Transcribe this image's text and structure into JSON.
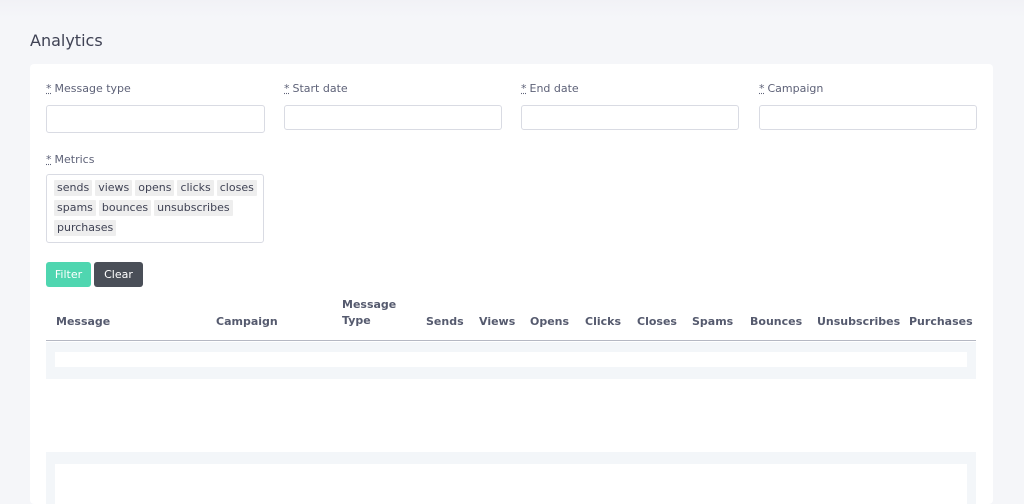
{
  "page": {
    "title": "Analytics"
  },
  "filters": {
    "required_mark": "*",
    "message_type": {
      "label": "Message type",
      "value": "",
      "placeholder": ""
    },
    "start_date": {
      "label": "Start date",
      "value": "",
      "placeholder": ""
    },
    "end_date": {
      "label": "End date",
      "value": "",
      "placeholder": ""
    },
    "campaign": {
      "label": "Campaign",
      "value": "",
      "placeholder": ""
    },
    "metrics": {
      "label": "Metrics",
      "selected": [
        "sends",
        "views",
        "opens",
        "clicks",
        "closes",
        "spams",
        "bounces",
        "unsubscribes",
        "purchases"
      ]
    }
  },
  "actions": {
    "filter_label": "Filter",
    "clear_label": "Clear"
  },
  "table": {
    "columns": [
      "Message",
      "Campaign",
      "Message Type",
      "Sends",
      "Views",
      "Opens",
      "Clicks",
      "Closes",
      "Spams",
      "Bounces",
      "Unsubscribes",
      "Purchases"
    ],
    "rows": []
  },
  "colors": {
    "accent": "#4fd6b0",
    "dark_button": "#4a4f58",
    "background": "#f5f6f9"
  }
}
